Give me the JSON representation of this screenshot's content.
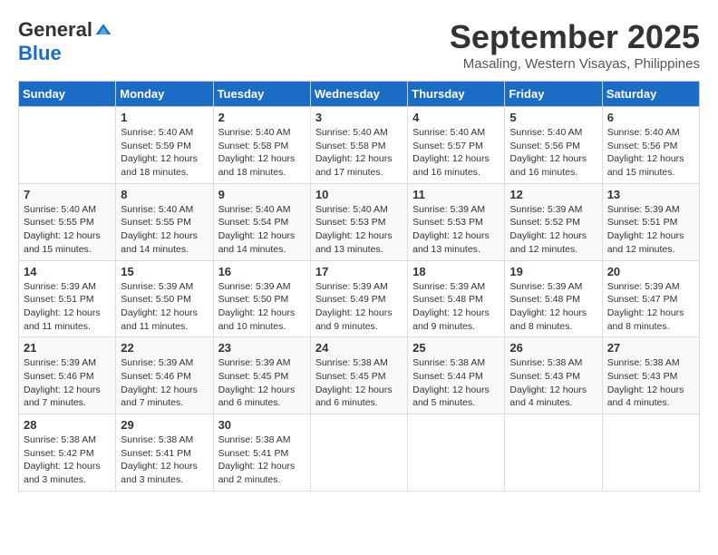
{
  "header": {
    "logo_general": "General",
    "logo_blue": "Blue",
    "month_title": "September 2025",
    "location": "Masaling, Western Visayas, Philippines"
  },
  "days_of_week": [
    "Sunday",
    "Monday",
    "Tuesday",
    "Wednesday",
    "Thursday",
    "Friday",
    "Saturday"
  ],
  "weeks": [
    [
      {
        "day": "",
        "sunrise": "",
        "sunset": "",
        "daylight": ""
      },
      {
        "day": "1",
        "sunrise": "Sunrise: 5:40 AM",
        "sunset": "Sunset: 5:59 PM",
        "daylight": "Daylight: 12 hours and 18 minutes."
      },
      {
        "day": "2",
        "sunrise": "Sunrise: 5:40 AM",
        "sunset": "Sunset: 5:58 PM",
        "daylight": "Daylight: 12 hours and 18 minutes."
      },
      {
        "day": "3",
        "sunrise": "Sunrise: 5:40 AM",
        "sunset": "Sunset: 5:58 PM",
        "daylight": "Daylight: 12 hours and 17 minutes."
      },
      {
        "day": "4",
        "sunrise": "Sunrise: 5:40 AM",
        "sunset": "Sunset: 5:57 PM",
        "daylight": "Daylight: 12 hours and 16 minutes."
      },
      {
        "day": "5",
        "sunrise": "Sunrise: 5:40 AM",
        "sunset": "Sunset: 5:56 PM",
        "daylight": "Daylight: 12 hours and 16 minutes."
      },
      {
        "day": "6",
        "sunrise": "Sunrise: 5:40 AM",
        "sunset": "Sunset: 5:56 PM",
        "daylight": "Daylight: 12 hours and 15 minutes."
      }
    ],
    [
      {
        "day": "7",
        "sunrise": "Sunrise: 5:40 AM",
        "sunset": "Sunset: 5:55 PM",
        "daylight": "Daylight: 12 hours and 15 minutes."
      },
      {
        "day": "8",
        "sunrise": "Sunrise: 5:40 AM",
        "sunset": "Sunset: 5:55 PM",
        "daylight": "Daylight: 12 hours and 14 minutes."
      },
      {
        "day": "9",
        "sunrise": "Sunrise: 5:40 AM",
        "sunset": "Sunset: 5:54 PM",
        "daylight": "Daylight: 12 hours and 14 minutes."
      },
      {
        "day": "10",
        "sunrise": "Sunrise: 5:40 AM",
        "sunset": "Sunset: 5:53 PM",
        "daylight": "Daylight: 12 hours and 13 minutes."
      },
      {
        "day": "11",
        "sunrise": "Sunrise: 5:39 AM",
        "sunset": "Sunset: 5:53 PM",
        "daylight": "Daylight: 12 hours and 13 minutes."
      },
      {
        "day": "12",
        "sunrise": "Sunrise: 5:39 AM",
        "sunset": "Sunset: 5:52 PM",
        "daylight": "Daylight: 12 hours and 12 minutes."
      },
      {
        "day": "13",
        "sunrise": "Sunrise: 5:39 AM",
        "sunset": "Sunset: 5:51 PM",
        "daylight": "Daylight: 12 hours and 12 minutes."
      }
    ],
    [
      {
        "day": "14",
        "sunrise": "Sunrise: 5:39 AM",
        "sunset": "Sunset: 5:51 PM",
        "daylight": "Daylight: 12 hours and 11 minutes."
      },
      {
        "day": "15",
        "sunrise": "Sunrise: 5:39 AM",
        "sunset": "Sunset: 5:50 PM",
        "daylight": "Daylight: 12 hours and 11 minutes."
      },
      {
        "day": "16",
        "sunrise": "Sunrise: 5:39 AM",
        "sunset": "Sunset: 5:50 PM",
        "daylight": "Daylight: 12 hours and 10 minutes."
      },
      {
        "day": "17",
        "sunrise": "Sunrise: 5:39 AM",
        "sunset": "Sunset: 5:49 PM",
        "daylight": "Daylight: 12 hours and 9 minutes."
      },
      {
        "day": "18",
        "sunrise": "Sunrise: 5:39 AM",
        "sunset": "Sunset: 5:48 PM",
        "daylight": "Daylight: 12 hours and 9 minutes."
      },
      {
        "day": "19",
        "sunrise": "Sunrise: 5:39 AM",
        "sunset": "Sunset: 5:48 PM",
        "daylight": "Daylight: 12 hours and 8 minutes."
      },
      {
        "day": "20",
        "sunrise": "Sunrise: 5:39 AM",
        "sunset": "Sunset: 5:47 PM",
        "daylight": "Daylight: 12 hours and 8 minutes."
      }
    ],
    [
      {
        "day": "21",
        "sunrise": "Sunrise: 5:39 AM",
        "sunset": "Sunset: 5:46 PM",
        "daylight": "Daylight: 12 hours and 7 minutes."
      },
      {
        "day": "22",
        "sunrise": "Sunrise: 5:39 AM",
        "sunset": "Sunset: 5:46 PM",
        "daylight": "Daylight: 12 hours and 7 minutes."
      },
      {
        "day": "23",
        "sunrise": "Sunrise: 5:39 AM",
        "sunset": "Sunset: 5:45 PM",
        "daylight": "Daylight: 12 hours and 6 minutes."
      },
      {
        "day": "24",
        "sunrise": "Sunrise: 5:38 AM",
        "sunset": "Sunset: 5:45 PM",
        "daylight": "Daylight: 12 hours and 6 minutes."
      },
      {
        "day": "25",
        "sunrise": "Sunrise: 5:38 AM",
        "sunset": "Sunset: 5:44 PM",
        "daylight": "Daylight: 12 hours and 5 minutes."
      },
      {
        "day": "26",
        "sunrise": "Sunrise: 5:38 AM",
        "sunset": "Sunset: 5:43 PM",
        "daylight": "Daylight: 12 hours and 4 minutes."
      },
      {
        "day": "27",
        "sunrise": "Sunrise: 5:38 AM",
        "sunset": "Sunset: 5:43 PM",
        "daylight": "Daylight: 12 hours and 4 minutes."
      }
    ],
    [
      {
        "day": "28",
        "sunrise": "Sunrise: 5:38 AM",
        "sunset": "Sunset: 5:42 PM",
        "daylight": "Daylight: 12 hours and 3 minutes."
      },
      {
        "day": "29",
        "sunrise": "Sunrise: 5:38 AM",
        "sunset": "Sunset: 5:41 PM",
        "daylight": "Daylight: 12 hours and 3 minutes."
      },
      {
        "day": "30",
        "sunrise": "Sunrise: 5:38 AM",
        "sunset": "Sunset: 5:41 PM",
        "daylight": "Daylight: 12 hours and 2 minutes."
      },
      {
        "day": "",
        "sunrise": "",
        "sunset": "",
        "daylight": ""
      },
      {
        "day": "",
        "sunrise": "",
        "sunset": "",
        "daylight": ""
      },
      {
        "day": "",
        "sunrise": "",
        "sunset": "",
        "daylight": ""
      },
      {
        "day": "",
        "sunrise": "",
        "sunset": "",
        "daylight": ""
      }
    ]
  ]
}
